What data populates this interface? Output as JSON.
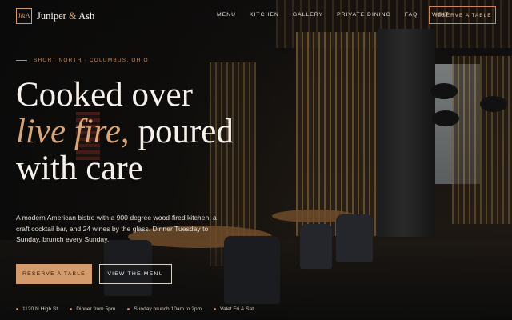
{
  "brand": {
    "mark": "J&A",
    "name_first": "Juniper",
    "amp": "&",
    "name_last": "Ash"
  },
  "nav": {
    "links": [
      "MENU",
      "KITCHEN",
      "GALLERY",
      "PRIVATE DINING",
      "FAQ",
      "VISIT"
    ],
    "cta": "RESERVE A TABLE"
  },
  "hero": {
    "eyebrow": "SHORT NORTH · COLUMBUS, OHIO",
    "line1": "Cooked over",
    "line2_em": "live fire,",
    "line2_rest": " poured",
    "line3": "with care",
    "lede": "A modern American bistro with a 900 degree wood-fired kitchen, a craft cocktail bar, and 24 wines by the glass. Dinner Tuesday to Sunday, brunch every Sunday.",
    "primary_button": "RESERVE A TABLE",
    "secondary_button": "VIEW THE MENU"
  },
  "facts": [
    "1120 N High St",
    "Dinner from 5pm",
    "Sunday brunch 10am to 2pm",
    "Valet Fri & Sat"
  ],
  "colors": {
    "accent": "#d39a6c",
    "background": "#121212",
    "text": "#f4eee6"
  }
}
